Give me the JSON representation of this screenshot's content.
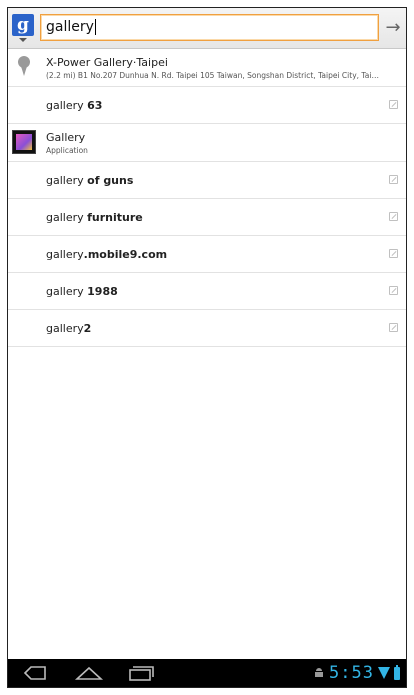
{
  "search": {
    "query": "gallery",
    "go_icon": "arrow-right-icon",
    "source_icon": "google-icon",
    "source_letter": "g"
  },
  "suggestions": [
    {
      "kind": "place",
      "icon": "map-pin-icon",
      "title": "X-Power Gallery·Taipei",
      "subtitle": "(2.2 mi) B1 No.207 Dunhua N. Rd. Taipei 105 Taiwan, Songshan District, Taipei City, Taiwan 1..."
    },
    {
      "kind": "query",
      "prefix": "gallery ",
      "bold": "63"
    },
    {
      "kind": "app",
      "icon": "gallery-app-icon",
      "title": "Gallery",
      "subtitle": "Application"
    },
    {
      "kind": "query",
      "prefix": "gallery ",
      "bold": "of guns"
    },
    {
      "kind": "query",
      "prefix": "gallery ",
      "bold": "furniture"
    },
    {
      "kind": "query",
      "prefix": "gallery",
      "bold": ".mobile9.com"
    },
    {
      "kind": "query",
      "prefix": "gallery ",
      "bold": "1988"
    },
    {
      "kind": "query",
      "prefix": "gallery",
      "bold": "2"
    }
  ],
  "status_bar": {
    "time": "5:53",
    "accent_color": "#33b5e5"
  }
}
